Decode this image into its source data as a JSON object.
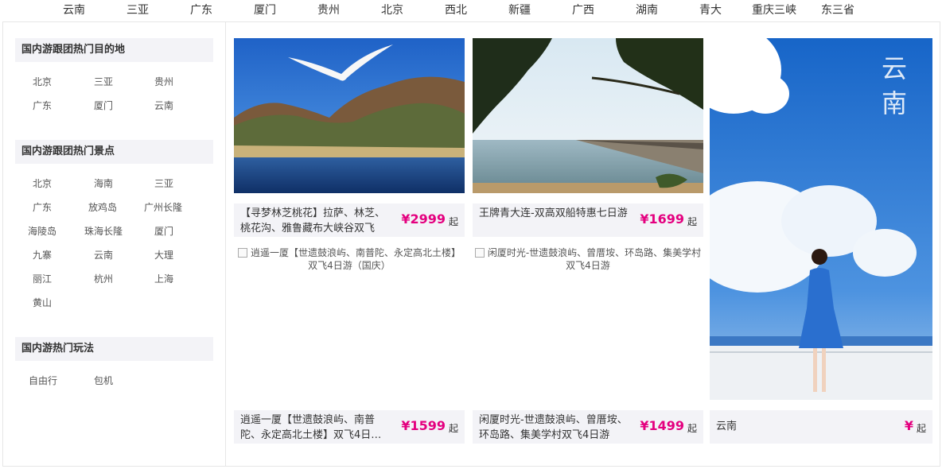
{
  "topnav": [
    "云南",
    "三亚",
    "广东",
    "厦门",
    "贵州",
    "北京",
    "西北",
    "新疆",
    "广西",
    "湖南",
    "青大",
    "重庆三峡",
    "东三省"
  ],
  "sidebar": {
    "sections": [
      {
        "title": "国内游跟团热门目的地",
        "links": [
          "北京",
          "三亚",
          "贵州",
          "广东",
          "厦门",
          "云南"
        ]
      },
      {
        "title": "国内游跟团热门景点",
        "links": [
          "北京",
          "海南",
          "三亚",
          "广东",
          "放鸡岛",
          "广州长隆",
          "海陵岛",
          "珠海长隆",
          "厦门",
          "九寨",
          "云南",
          "大理",
          "丽江",
          "杭州",
          "上海",
          "黄山"
        ]
      },
      {
        "title": "国内游热门玩法",
        "links": [
          "自由行",
          "包机"
        ]
      }
    ]
  },
  "cards": [
    {
      "title": "【寻梦林芝桃花】拉萨、林芝、桃花沟、雅鲁藏布大峡谷双飞",
      "price": "¥2999",
      "unit": "起",
      "image": "lake-mountain-seagull"
    },
    {
      "title": "王牌青大连-双高双船特惠七日游",
      "price": "¥1699",
      "unit": "起",
      "image": "pine-pier-sea"
    },
    {
      "title": "逍遥一厦【世遗鼓浪屿、南普陀、永定高北土楼】双飞4日游（国庆）",
      "price": "¥1599",
      "unit": "起",
      "alt": "逍遥一厦【世遗鼓浪屿、南普陀、永定高北土楼】双飞4日游（国庆）"
    },
    {
      "title": "闲厦时光-世遗鼓浪屿、曾厝垵、环岛路、集美学村双飞4日游",
      "price": "¥1499",
      "unit": "起",
      "alt": "闲厦时光-世遗鼓浪屿、曾厝垵、环岛路、集美学村双飞4日游"
    }
  ],
  "feature": {
    "caption": "云南",
    "title": "云南",
    "price": "¥",
    "unit": "起",
    "image": "sky-girl-blue-dress"
  },
  "colors": {
    "price": "#e4007f",
    "panel": "#f3f3f7",
    "sky": "#1f6fd6"
  }
}
